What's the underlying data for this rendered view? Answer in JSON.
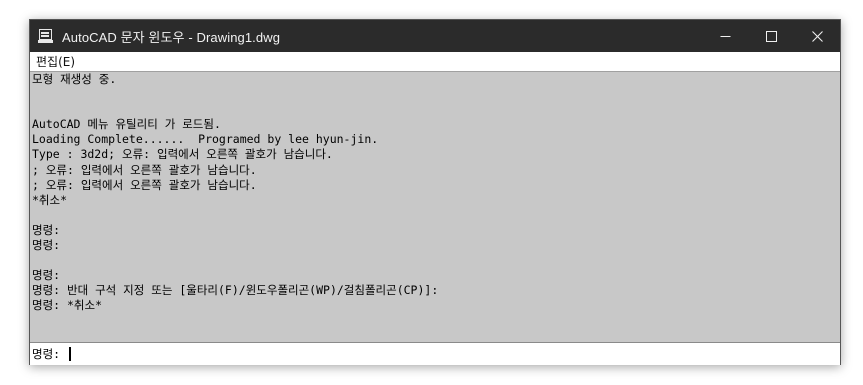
{
  "window": {
    "title": "AutoCAD 문자 윈도우 - Drawing1.dwg",
    "icon": "text-window-icon",
    "controls": {
      "minimize": "minimize-icon",
      "maximize": "maximize-icon",
      "close": "close-icon"
    }
  },
  "menubar": {
    "items": [
      {
        "label": "편집(E)"
      }
    ]
  },
  "history": {
    "lines": [
      "모형 재생성 중.",
      "",
      "",
      "AutoCAD 메뉴 유틸리티 가 로드됨.",
      "Loading Complete......  Programed by lee hyun-jin.",
      "Type : 3d2d; 오류: 입력에서 오른쪽 괄호가 남습니다.",
      "; 오류: 입력에서 오른쪽 괄호가 남습니다.",
      "; 오류: 입력에서 오른쪽 괄호가 남습니다.",
      "*취소*",
      "",
      "명령:",
      "명령:",
      "",
      "명령:",
      "명령: 반대 구석 지정 또는 [울타리(F)/윈도우폴리곤(WP)/걸침폴리곤(CP)]:",
      "명령: *취소*"
    ]
  },
  "command_line": {
    "prompt": "명령: ",
    "value": ""
  }
}
